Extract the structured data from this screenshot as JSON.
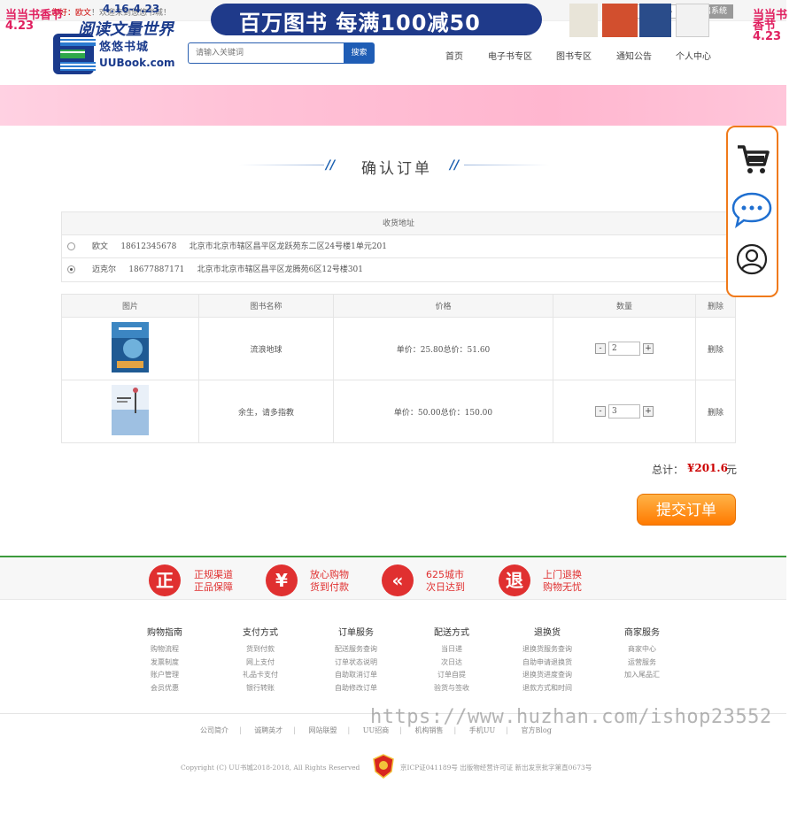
{
  "topbar": {
    "greeting_prefix": "您好：",
    "greeting_user": "欧文",
    "greeting_suffix": "！欢迎来到悠悠书城！",
    "user_center": "个人中心",
    "logout": "退出系统"
  },
  "header": {
    "logo_cn": "悠悠书城",
    "logo_en": "UUBook.com",
    "search_placeholder": "请输入关键词",
    "search_button": "搜索",
    "nav": [
      "首页",
      "电子书专区",
      "图书专区",
      "通知公告",
      "个人中心"
    ]
  },
  "banner": {
    "date": "4.16-4.23",
    "subtitle": "阅读文量世界",
    "logo": "当当书香节 4.23",
    "slogan": "百万图书 每满100减50"
  },
  "page_title": "确认订单",
  "address": {
    "header": "收货地址",
    "items": [
      {
        "name": "欧文",
        "phone": "18612345678",
        "address": "北京市北京市辖区昌平区龙跃苑东二区24号楼1单元201",
        "selected": false
      },
      {
        "name": "迈克尔",
        "phone": "18677887171",
        "address": "北京市北京市辖区昌平区龙腾苑6区12号楼301",
        "selected": true
      }
    ]
  },
  "cart": {
    "headers": [
      "图片",
      "图书名称",
      "价格",
      "数量",
      "删除"
    ],
    "rows": [
      {
        "name": "流浪地球",
        "price": "单价：25.80总价：51.60",
        "qty": "2",
        "minus": "-",
        "plus": "+",
        "delete": "删除",
        "cover_color": "#2f6fa8"
      },
      {
        "name": "余生，请多指教",
        "price": "单价：50.00总价：150.00",
        "qty": "3",
        "minus": "-",
        "plus": "+",
        "delete": "删除",
        "cover_color": "#8fb4d8"
      }
    ]
  },
  "total": {
    "label": "总计：",
    "value": "¥201.6",
    "unit": "元"
  },
  "submit_button": "提交订单",
  "guarantees": [
    {
      "icon_char": "正",
      "line1": "正规渠道",
      "line2": "正品保障"
    },
    {
      "icon_char": "¥",
      "line1": "放心购物",
      "line2": "货到付款"
    },
    {
      "icon_char": "«",
      "line1": "625城市",
      "line2": "次日达到"
    },
    {
      "icon_char": "退",
      "line1": "上门退换",
      "line2": "购物无忧"
    }
  ],
  "footer": {
    "columns": [
      {
        "title": "购物指南",
        "items": [
          "购物流程",
          "发票制度",
          "账户管理",
          "会员优惠"
        ]
      },
      {
        "title": "支付方式",
        "items": [
          "货到付款",
          "网上支付",
          "礼品卡支付",
          "银行转账"
        ]
      },
      {
        "title": "订单服务",
        "items": [
          "配送服务查询",
          "订单状态说明",
          "自助取消订单",
          "自助修改订单"
        ]
      },
      {
        "title": "配送方式",
        "items": [
          "当日递",
          "次日达",
          "订单自提",
          "验货与签收"
        ]
      },
      {
        "title": "退换货",
        "items": [
          "退换货服务查询",
          "自助申请退换货",
          "退换货进度查询",
          "退款方式和时间"
        ]
      },
      {
        "title": "商家服务",
        "items": [
          "商家中心",
          "运营服务",
          "加入尾品汇"
        ]
      }
    ],
    "links": [
      "公司简介",
      "诚聘英才",
      "网站联盟",
      "UU招商",
      "机构销售",
      "手机UU",
      "官方Blog"
    ],
    "copyright": "Copyright (C) UU书城2018-2018, All Rights Reserved",
    "license": "京ICP证041189号 出版物经营许可证 新出发京批字第直0673号"
  },
  "watermark": "https://www.huzhan.com/ishop23552",
  "colors": {
    "accent_blue": "#1f5db5",
    "accent_orange": "#ff7a00",
    "price_red": "#cc0000",
    "guarantee_red": "#e03030"
  }
}
